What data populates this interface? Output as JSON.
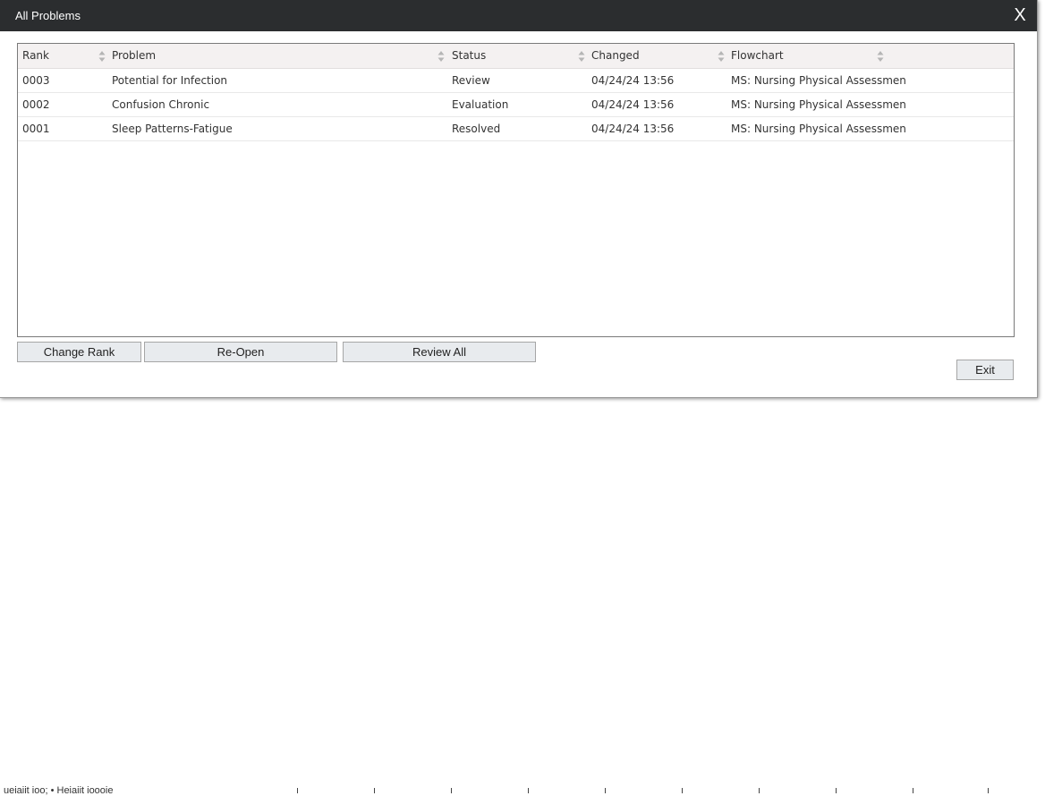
{
  "dialog": {
    "title": "All Problems",
    "close_label": "X"
  },
  "columns": [
    "Rank",
    "Problem",
    "Status",
    "Changed",
    "Flowchart"
  ],
  "rows": [
    {
      "rank": "0003",
      "problem": "Potential for Infection",
      "status": "Review",
      "changed": "04/24/24 13:56",
      "flowchart": "MS: Nursing Physical Assessmen"
    },
    {
      "rank": "0002",
      "problem": "Confusion Chronic",
      "status": "Evaluation",
      "changed": "04/24/24 13:56",
      "flowchart": "MS: Nursing Physical Assessmen"
    },
    {
      "rank": "0001",
      "problem": "Sleep Patterns-Fatigue",
      "status": "Resolved",
      "changed": "04/24/24 13:56",
      "flowchart": "MS: Nursing Physical Assessmen"
    }
  ],
  "buttons": {
    "change_rank": "Change Rank",
    "reopen": "Re-Open",
    "review_all": "Review All",
    "exit": "Exit"
  },
  "background": {
    "fragment": "ueiaiit ioo; • Heiaiit ioooie"
  },
  "icons": {
    "sort": "sort-updown-icon",
    "close": "close-icon"
  },
  "colors": {
    "titlebar": "#2b2d2f",
    "header_bg": "#f4f1f1",
    "button_bg": "#e8ebee"
  }
}
